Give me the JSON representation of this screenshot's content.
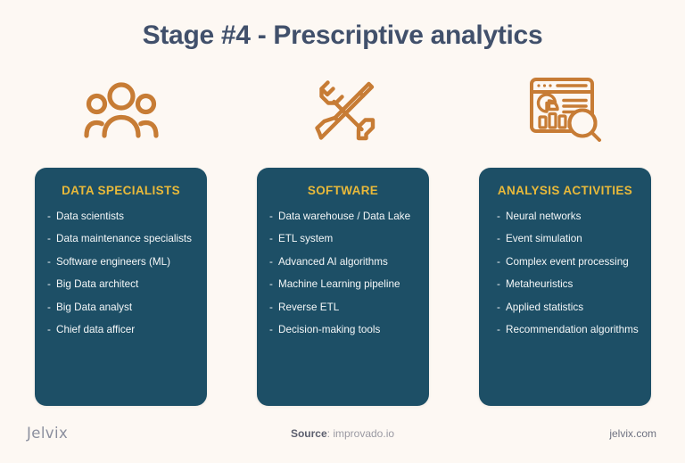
{
  "page": {
    "title": "Stage #4 - Prescriptive analytics",
    "background_color": "#fdf8f3",
    "title_color": "#41506b",
    "card_color": "#1d4f66",
    "heading_color": "#e8b93a",
    "icon_color": "#c77c35"
  },
  "columns": [
    {
      "icon": "people-group-icon",
      "heading": "DATA SPECIALISTS",
      "items": [
        "Data scientists",
        "Data maintenance specialists",
        "Software engineers (ML)",
        "Big Data architect",
        "Big Data analyst",
        "Chief data afficer"
      ]
    },
    {
      "icon": "tools-wrench-screwdriver-icon",
      "heading": "SOFTWARE",
      "items": [
        "Data warehouse / Data Lake",
        "ETL system",
        "Advanced AI algorithms",
        "Machine Learning pipeline",
        "Reverse ETL",
        "Decision-making tools"
      ]
    },
    {
      "icon": "analytics-dashboard-search-icon",
      "heading": "ANALYSIS ACTIVITIES",
      "items": [
        "Neural networks",
        "Event simulation",
        "Complex event processing",
        "Metaheuristics",
        "Applied statistics",
        "Recommendation algorithms"
      ]
    }
  ],
  "footer": {
    "brand": "Jelvix",
    "source_label": "Source",
    "source_separator": ": ",
    "source_value": "improvado.io",
    "website": "jelvix.com"
  }
}
